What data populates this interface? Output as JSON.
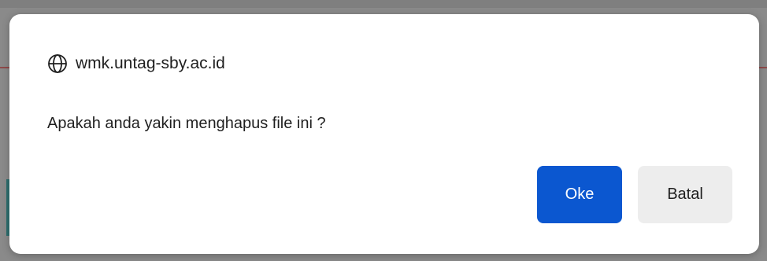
{
  "dialog": {
    "origin": "wmk.untag-sby.ac.id",
    "origin_icon": "globe-icon",
    "message": "Apakah anda yakin menghapus file ini ?",
    "ok_label": "Oke",
    "cancel_label": "Batal"
  },
  "colors": {
    "ok_button": "#0b57d0",
    "cancel_button": "#ededed",
    "backdrop": "#8a8a8a"
  }
}
